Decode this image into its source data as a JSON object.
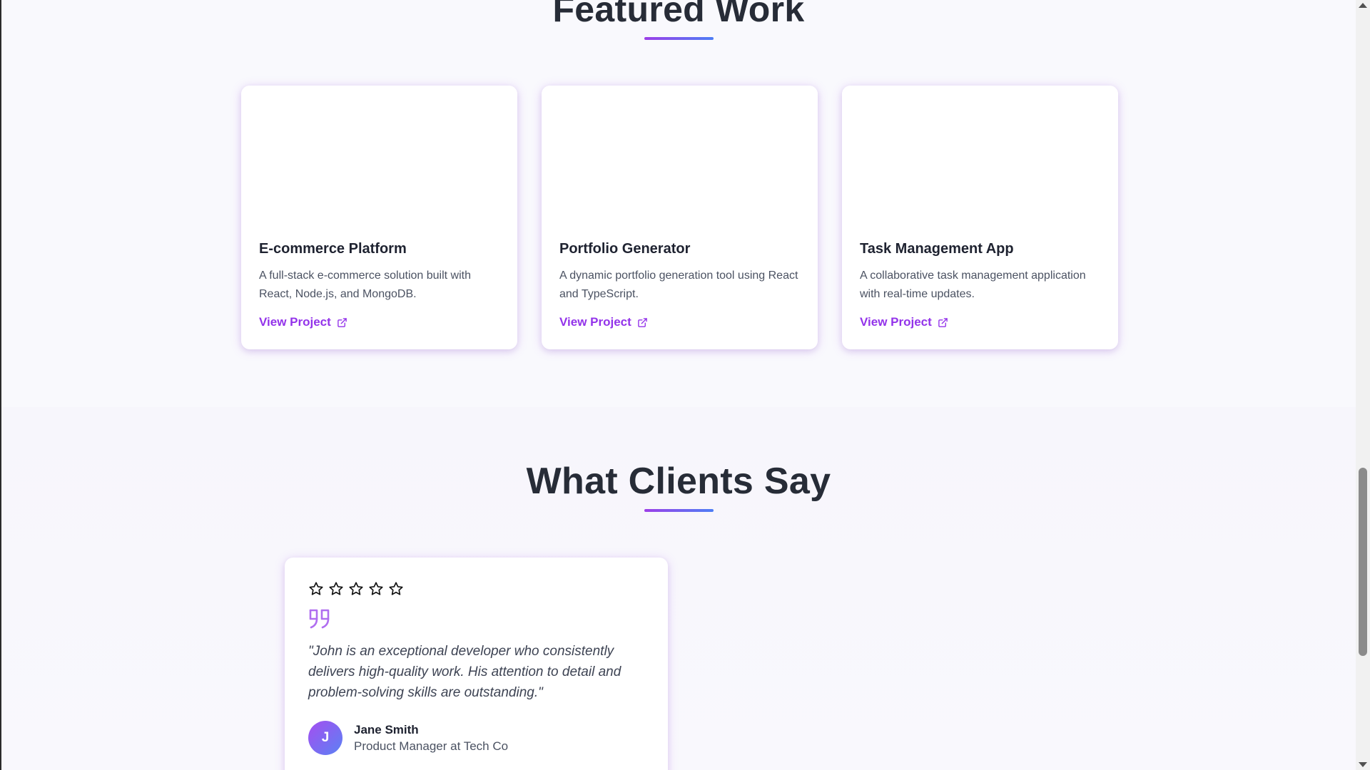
{
  "featured": {
    "title": "Featured Work",
    "projects": [
      {
        "title": "E-commerce Platform",
        "description": "A full-stack e-commerce solution built with React, Node.js, and MongoDB.",
        "link_label": "View Project",
        "link_icon": "external-link-icon"
      },
      {
        "title": "Portfolio Generator",
        "description": "A dynamic portfolio generation tool using React and TypeScript.",
        "link_label": "View Project",
        "link_icon": "external-link-icon"
      },
      {
        "title": "Task Management App",
        "description": "A collaborative task management application with real-time updates.",
        "link_label": "View Project",
        "link_icon": "external-link-icon"
      }
    ]
  },
  "testimonials": {
    "title": "What Clients Say",
    "items": [
      {
        "rating": 5,
        "rating_icon": "star-outline-icon",
        "quote_icon": "quote-icon",
        "quote": "\"John is an exceptional developer who consistently delivers high-quality work. His attention to detail and problem-solving skills are outstanding.\"",
        "author_initial": "J",
        "author_name": "Jane Smith",
        "author_role": "Product Manager at Tech Co"
      }
    ]
  },
  "colors": {
    "accent": "#9333ea",
    "gradient_start": "#9d3fe8",
    "gradient_end": "#4d7ef5",
    "heading": "#272c37",
    "body_text": "#4b5262"
  }
}
